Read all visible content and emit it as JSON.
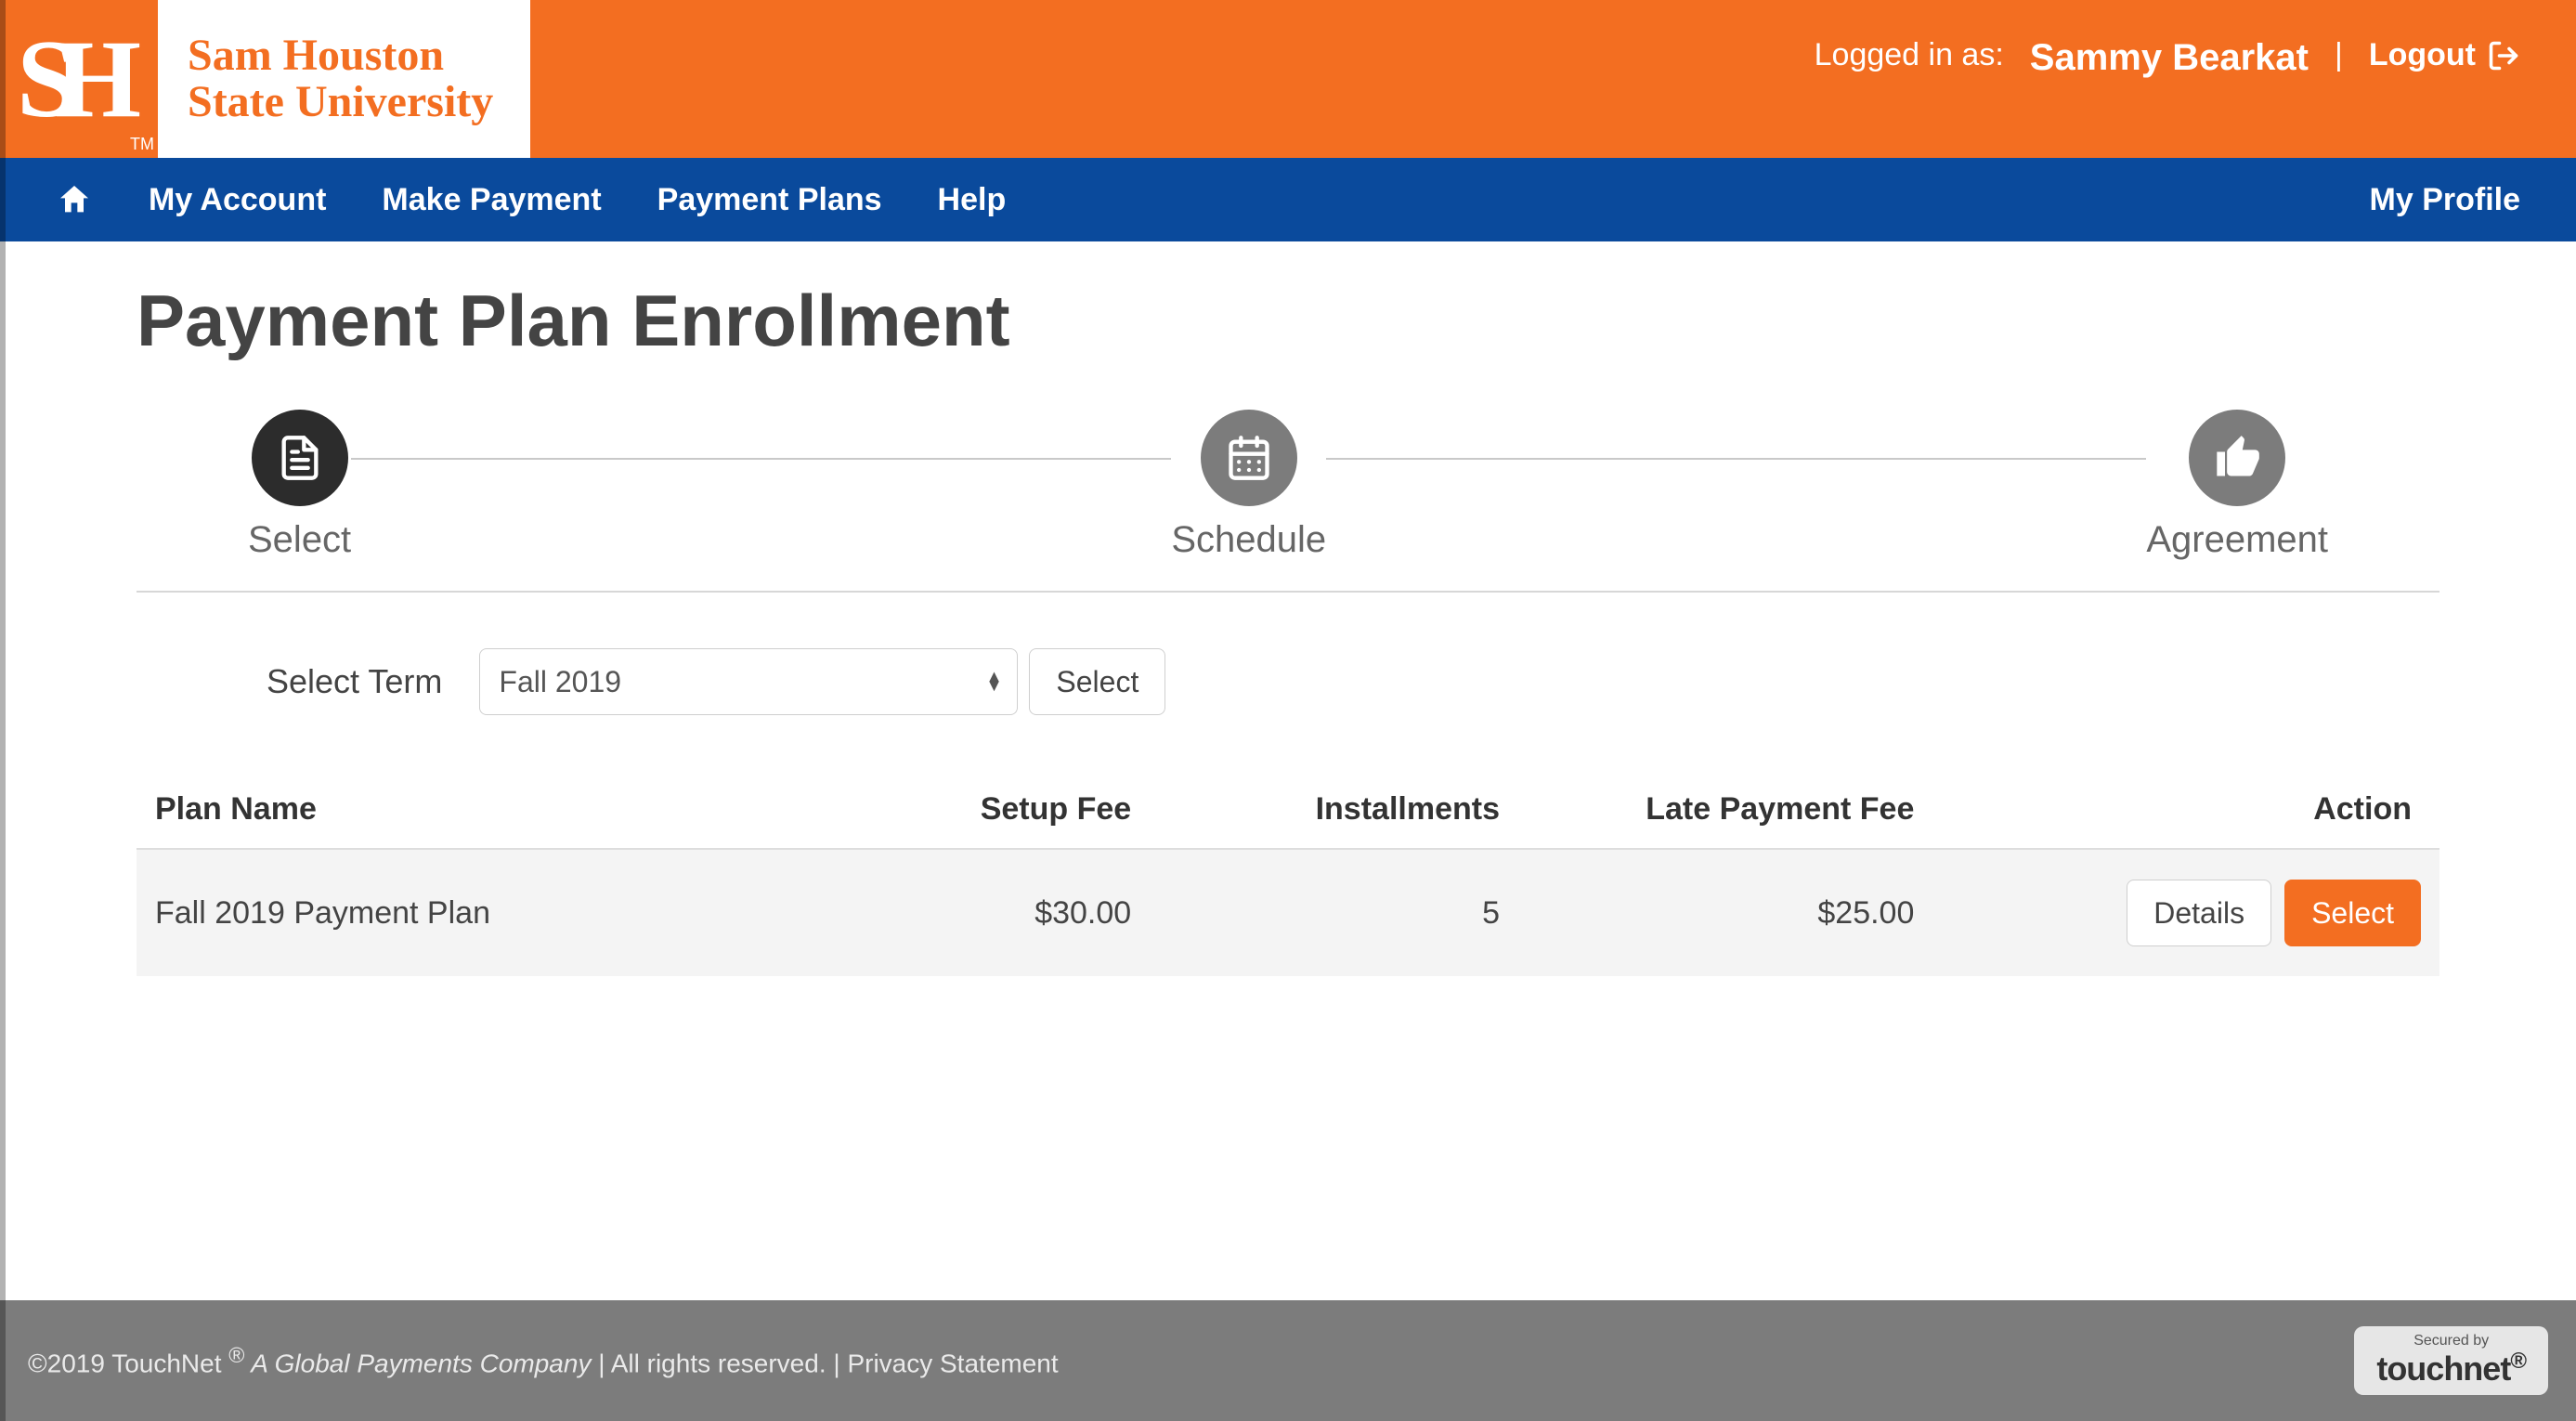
{
  "header": {
    "logo_line1": "Sam Houston",
    "logo_line2": "State University",
    "logged_in_label": "Logged in as:",
    "user_name": "Sammy Bearkat",
    "logout_label": "Logout"
  },
  "nav": {
    "items": [
      "My Account",
      "Make Payment",
      "Payment Plans",
      "Help"
    ],
    "profile": "My Profile"
  },
  "main": {
    "title": "Payment Plan Enrollment",
    "steps": [
      {
        "label": "Select"
      },
      {
        "label": "Schedule"
      },
      {
        "label": "Agreement"
      }
    ],
    "term": {
      "label": "Select Term",
      "selected": "Fall 2019",
      "select_button": "Select"
    },
    "table": {
      "headers": {
        "plan_name": "Plan Name",
        "setup_fee": "Setup Fee",
        "installments": "Installments",
        "late_fee": "Late Payment Fee",
        "action": "Action"
      },
      "rows": [
        {
          "plan_name": "Fall 2019 Payment Plan",
          "setup_fee": "$30.00",
          "installments": "5",
          "late_fee": "$25.00",
          "details_label": "Details",
          "select_label": "Select"
        }
      ]
    }
  },
  "footer": {
    "copyright_prefix": "©2019 TouchNet ",
    "reg": "®",
    "a_gp_company": " A Global Payments Company",
    "rights": " | All rights reserved. | ",
    "privacy": "Privacy Statement",
    "badge_small": "Secured by",
    "badge_brand": "touchnet"
  },
  "colors": {
    "orange": "#f36e21",
    "navy": "#0a4a9c",
    "footer_gray": "#7c7c7c"
  }
}
